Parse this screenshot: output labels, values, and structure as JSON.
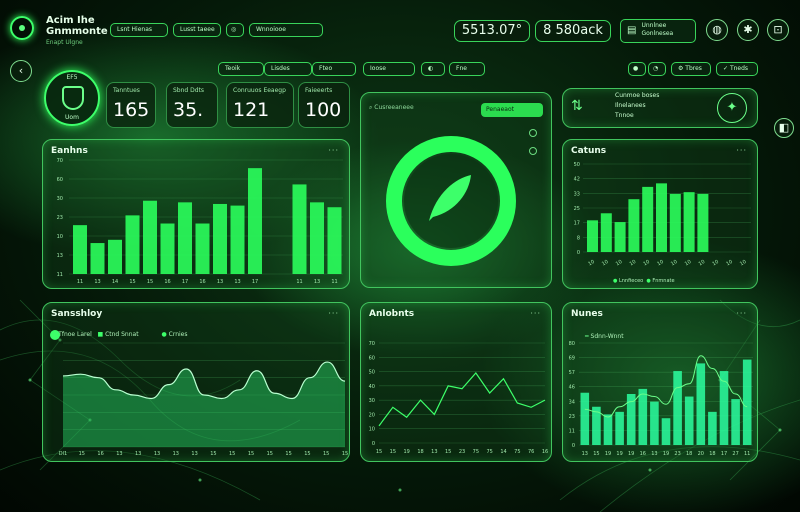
{
  "header": {
    "title_line1": "Acim Ihe",
    "title_line2": "Gnmmonte",
    "subtitle": "Enapt Ulgne",
    "nav_pills": [
      "Lsnt Hienas",
      "Lusst taeee",
      "Al",
      "Wnnoiooe"
    ],
    "stat_values": [
      "5513.07°",
      "8 580ack"
    ],
    "account_label_1": "Unnlnee",
    "account_label_2": "Gonlnesea"
  },
  "filters": {
    "tabs": [
      "Teoik",
      "Lisdes",
      "Fteo",
      "Ioose",
      "Fne"
    ],
    "right_buttons": [
      "",
      "Tbres",
      "Tneds"
    ]
  },
  "kpis": {
    "badge_top": "EF5",
    "badge_bottom": "Uom",
    "items": [
      {
        "label": "Tanntues",
        "value": "165"
      },
      {
        "label": "Sbnd Ddts",
        "value": "35."
      },
      {
        "label": "Conruuos Eeaegp",
        "value": "121"
      },
      {
        "label": "Faieeerts",
        "value": "100"
      }
    ]
  },
  "center_top": {
    "search_placeholder": "Cusreeaneee",
    "button_label": "Penaeaot"
  },
  "right_top": {
    "rows": [
      "Cunmoe boses",
      "Ilnelanees",
      "Tnnoe"
    ]
  },
  "panels": {
    "bar_left_title": "Eanhns",
    "bar_right_title": "Catuns",
    "area_title": "Sansshloy",
    "line_title": "Anlobnts",
    "combo_title": "Nunes",
    "area_legend": [
      "Tfnoe Larel",
      "Ctnd Snnat",
      "Crnies"
    ],
    "bar_right_legend": [
      "Lnnfieceo",
      "Fnmnate"
    ],
    "combo_legend": [
      "Sdnn-Wnnt"
    ]
  },
  "chart_data": [
    {
      "type": "bar",
      "title": "Eanhns",
      "categories": [
        "11",
        "13",
        "14",
        "15",
        "15",
        "16",
        "17",
        "16",
        "13",
        "13",
        "17",
        "11",
        "13",
        "11"
      ],
      "values": [
        30,
        19,
        21,
        36,
        45,
        31,
        44,
        31,
        43,
        42,
        65,
        55,
        44,
        41
      ],
      "ylim": [
        0,
        70
      ],
      "ytick_labels": [
        "11",
        "13",
        "10",
        "23",
        "30",
        "60",
        "70"
      ]
    },
    {
      "type": "bar",
      "title": "Catuns",
      "categories": [
        "10",
        "10",
        "10",
        "10",
        "10",
        "10",
        "10",
        "10",
        "10",
        "10",
        "10",
        "10"
      ],
      "values": [
        18,
        22,
        17,
        30,
        37,
        39,
        33,
        34,
        33,
        0,
        0,
        0
      ],
      "ylim": [
        0,
        50
      ]
    },
    {
      "type": "area",
      "title": "Sansshloy",
      "series": [
        {
          "name": "Tfnoe Larel",
          "values": [
            41,
            42,
            40,
            33,
            30,
            28,
            36,
            45,
            30,
            28,
            33,
            44,
            31,
            28,
            40,
            49,
            38
          ]
        }
      ],
      "ylim": [
        0,
        60
      ]
    },
    {
      "type": "line",
      "title": "Anlobnts",
      "x": [
        "15",
        "15",
        "19",
        "18",
        "13",
        "15",
        "23",
        "75",
        "75",
        "14",
        "75",
        "76",
        "16"
      ],
      "values": [
        12,
        25,
        18,
        30,
        20,
        40,
        38,
        49,
        35,
        45,
        28,
        25,
        30
      ],
      "ylim": [
        0,
        70
      ]
    },
    {
      "type": "bar",
      "title": "Nunes",
      "categories": [
        "13",
        "15",
        "19",
        "19",
        "19",
        "16",
        "13",
        "19",
        "23",
        "18",
        "20",
        "18",
        "17",
        "27",
        "11"
      ],
      "values": [
        41,
        30,
        24,
        26,
        40,
        44,
        34,
        21,
        58,
        38,
        64,
        26,
        58,
        36,
        67
      ],
      "line": [
        28,
        26,
        22,
        30,
        34,
        40,
        38,
        32,
        45,
        48,
        70,
        60,
        50,
        40,
        30
      ],
      "ylim": [
        0,
        80
      ]
    }
  ],
  "donut": {
    "percent": 100
  }
}
